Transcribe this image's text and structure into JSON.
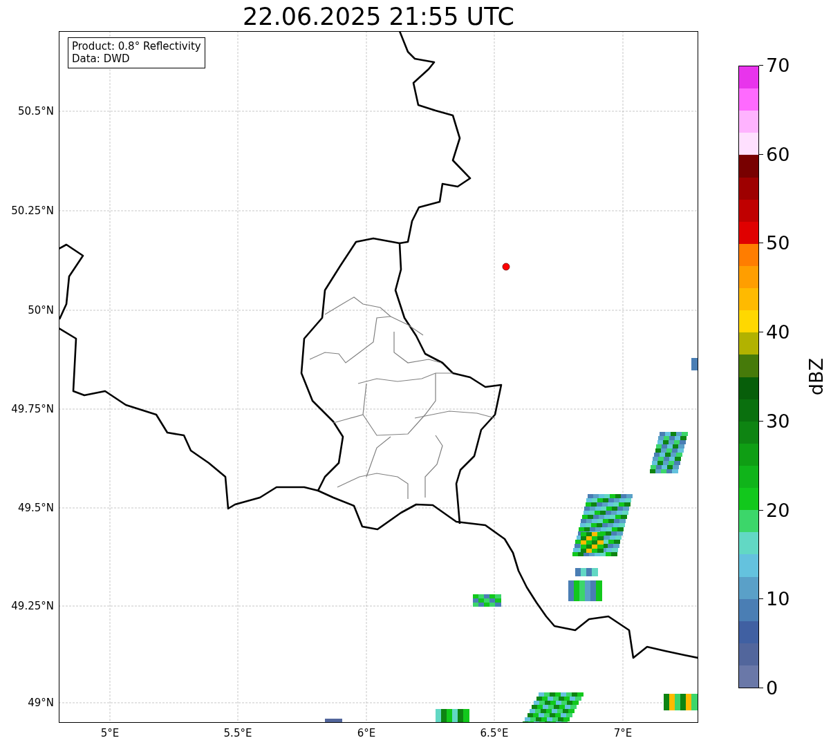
{
  "title": "22.06.2025 21:55 UTC",
  "info_box": {
    "lines": [
      "Product: 0.8° Reflectivity",
      "Data: DWD"
    ]
  },
  "map": {
    "x_tick_labels": [
      "5°E",
      "5.5°E",
      "6°E",
      "6.5°E",
      "7°E"
    ],
    "y_tick_labels": [
      "50.5°N",
      "50.25°N",
      "50°N",
      "49.75°N",
      "49.5°N",
      "49.25°N",
      "49°N"
    ]
  },
  "colorbar": {
    "label": "dBZ",
    "tick_labels": [
      "70",
      "60",
      "50",
      "40",
      "30",
      "20",
      "10",
      "0"
    ],
    "bins": [
      {
        "color": "#e834ec"
      },
      {
        "color": "#fe6afe"
      },
      {
        "color": "#feb3fe"
      },
      {
        "color": "#fee0fe"
      },
      {
        "color": "#780000"
      },
      {
        "color": "#9e0000"
      },
      {
        "color": "#c00000"
      },
      {
        "color": "#e00000"
      },
      {
        "color": "#ff7d00"
      },
      {
        "color": "#ff9e00"
      },
      {
        "color": "#ffba00"
      },
      {
        "color": "#ffd800"
      },
      {
        "color": "#b2b200"
      },
      {
        "color": "#467a0a"
      },
      {
        "color": "#075e0a"
      },
      {
        "color": "#0a700e"
      },
      {
        "color": "#0e8412"
      },
      {
        "color": "#0f9e14"
      },
      {
        "color": "#10b41a"
      },
      {
        "color": "#12c81c"
      },
      {
        "color": "#3cd66a"
      },
      {
        "color": "#62d8c4"
      },
      {
        "color": "#64c2de"
      },
      {
        "color": "#5aa0c8"
      },
      {
        "color": "#4a7eb4"
      },
      {
        "color": "#4060a2"
      },
      {
        "color": "#52669c"
      },
      {
        "color": "#6a78a8"
      }
    ]
  }
}
